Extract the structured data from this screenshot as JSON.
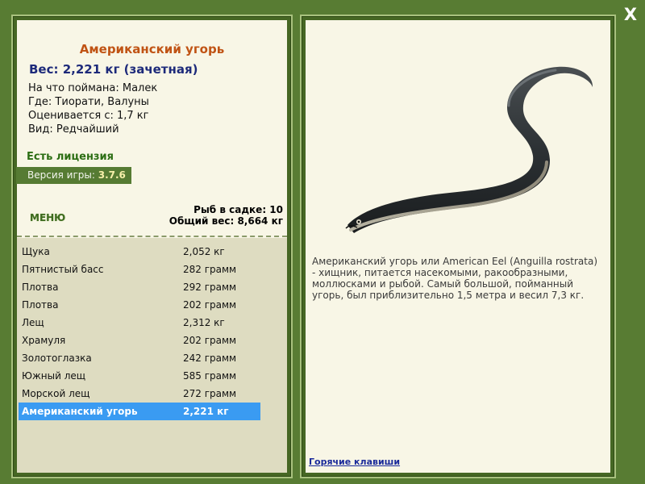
{
  "close_label": "X",
  "catch": {
    "fish_name": "Американский угорь",
    "weight_line": "Вес: 2,221 кг (зачетная)",
    "info_lines": [
      "На что поймана: Малек",
      "Где: Тиорати, Валуны",
      "Оценивается с: 1,7 кг",
      "Вид: Редчайший"
    ]
  },
  "license_text": "Есть лицензия",
  "version": {
    "label": "Версия игры:",
    "value": "3.7.6"
  },
  "menu_label": "МЕНЮ",
  "stats": {
    "fish_in_cage": "Рыб в садке: 10",
    "total_weight": "Общий вес: 8,664 кг"
  },
  "fish_list": [
    {
      "name": "Щука",
      "weight": "2,052 кг",
      "selected": false
    },
    {
      "name": "Пятнистый басс",
      "weight": "282 грамм",
      "selected": false
    },
    {
      "name": "Плотва",
      "weight": "292 грамм",
      "selected": false
    },
    {
      "name": "Плотва",
      "weight": "202 грамм",
      "selected": false
    },
    {
      "name": "Лещ",
      "weight": "2,312 кг",
      "selected": false
    },
    {
      "name": "Храмуля",
      "weight": "202 грамм",
      "selected": false
    },
    {
      "name": "Золотоглазка",
      "weight": "242 грамм",
      "selected": false
    },
    {
      "name": "Южный лещ",
      "weight": "585 грамм",
      "selected": false
    },
    {
      "name": "Морской лещ",
      "weight": "272 грамм",
      "selected": false
    },
    {
      "name": "Американский угорь",
      "weight": "2,221 кг",
      "selected": true
    }
  ],
  "description": "Американский угорь или American Eel (Anguilla rostrata) - хищник, питается насекомыми, ракообразными, моллюсками и рыбой. Самый большой, пойманный угорь, был приблизительно 1,5 метра и весил 7,3 кг.",
  "hotkeys_label": "Горячие клавиши",
  "colors": {
    "background": "#587c33",
    "panel": "#f8f6e6",
    "list": "#dedcc1",
    "selected_row": "#3a9bf2",
    "title": "#c05314"
  }
}
